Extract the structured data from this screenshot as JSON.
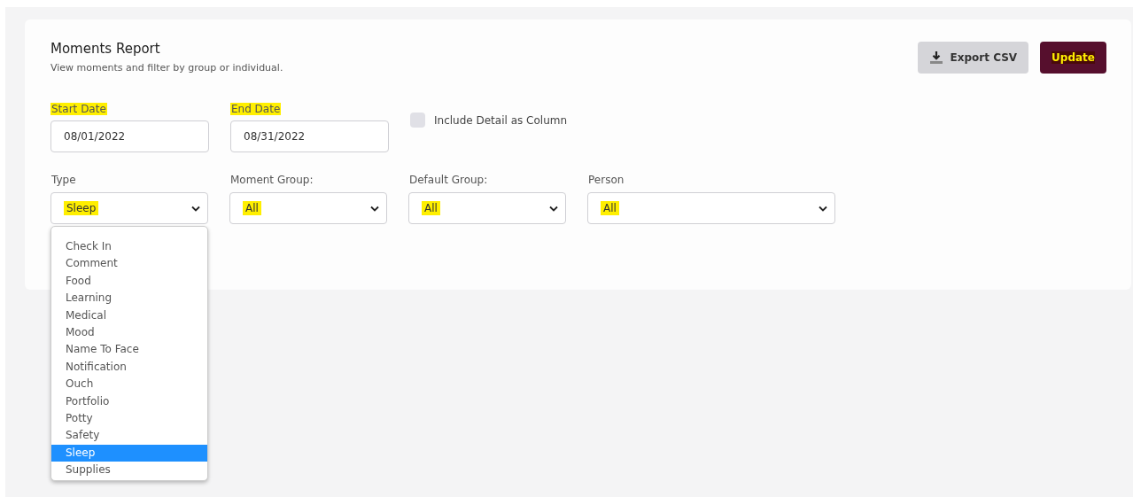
{
  "header": {
    "title": "Moments Report",
    "subtitle": "View moments and filter by group or individual."
  },
  "actions": [
    {
      "kind": "export",
      "label": "Export CSV"
    },
    {
      "kind": "update",
      "label": "Update",
      "highlighted": true
    }
  ],
  "date_fields": [
    {
      "label": "Start Date",
      "label_highlighted": true,
      "value": "08/01/2022"
    },
    {
      "label": "End Date",
      "label_highlighted": true,
      "value": "08/31/2022"
    }
  ],
  "include_detail": {
    "label": "Include Detail as Column",
    "checked": false
  },
  "filters": [
    {
      "label": "Type",
      "value": "Sleep",
      "value_highlighted": true,
      "expanded": true,
      "options": [
        {
          "label": "Check In",
          "selected": false
        },
        {
          "label": "Comment",
          "selected": false
        },
        {
          "label": "Food",
          "selected": false
        },
        {
          "label": "Learning",
          "selected": false
        },
        {
          "label": "Medical",
          "selected": false
        },
        {
          "label": "Mood",
          "selected": false
        },
        {
          "label": "Name To Face",
          "selected": false
        },
        {
          "label": "Notification",
          "selected": false
        },
        {
          "label": "Ouch",
          "selected": false
        },
        {
          "label": "Portfolio",
          "selected": false
        },
        {
          "label": "Potty",
          "selected": false
        },
        {
          "label": "Safety",
          "selected": false
        },
        {
          "label": "Sleep",
          "selected": true
        },
        {
          "label": "Supplies",
          "selected": false
        }
      ]
    },
    {
      "label": "Moment Group:",
      "value": "All",
      "value_highlighted": true
    },
    {
      "label": "Default Group:",
      "value": "All",
      "value_highlighted": true
    },
    {
      "label": "Person",
      "value": "All",
      "value_highlighted": true
    }
  ]
}
